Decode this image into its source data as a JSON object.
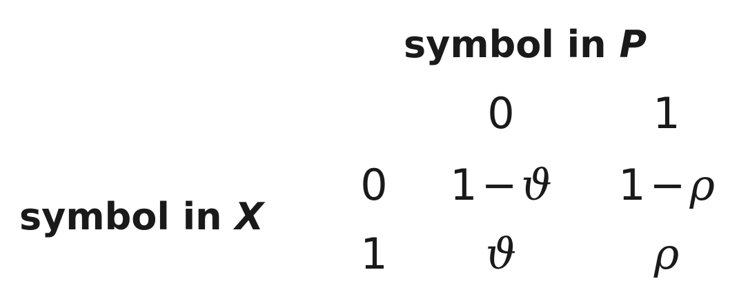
{
  "header": {
    "text": "symbol in ",
    "variable": "P"
  },
  "row_header": {
    "text": "symbol in ",
    "variable": "X"
  },
  "column_labels": [
    "0",
    "1"
  ],
  "row_labels": [
    "0",
    "1"
  ],
  "cells": {
    "r0c0": {
      "prefix": "1",
      "operator": "−",
      "symbol": "ϑ"
    },
    "r0c1": {
      "prefix": "1",
      "operator": "−",
      "symbol": "ρ"
    },
    "r1c0": {
      "symbol": "ϑ"
    },
    "r1c1": {
      "symbol": "ρ"
    }
  }
}
